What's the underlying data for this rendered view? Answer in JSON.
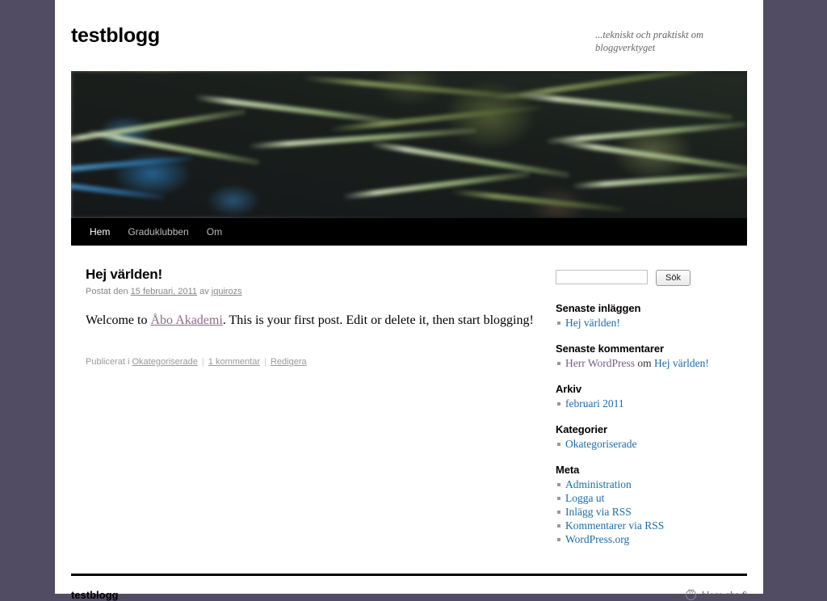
{
  "theme": {
    "background_color": "#514b63",
    "page_background": "#ffffff",
    "nav_background": "#000000",
    "link_color": "#1b6ca8",
    "visited_link_color": "#7a5a8e",
    "meta_text_color": "#888888"
  },
  "header": {
    "site_title": "testblogg",
    "site_description": "...tekniskt och praktiskt om bloggverktyget",
    "header_image_alt": "fern fronds photograph"
  },
  "nav": {
    "items": [
      {
        "label": "Hem",
        "current": true
      },
      {
        "label": "Graduklubben",
        "current": false
      },
      {
        "label": "Om",
        "current": false
      }
    ]
  },
  "post": {
    "title": "Hej världen!",
    "meta_prefix": "Postat den",
    "date": "15 februari, 2011",
    "meta_by": "av",
    "author": "jquirozs",
    "content_before_link": "Welcome to ",
    "content_link": "Åbo Akademi",
    "content_after_link": ". This is your first post. Edit or delete it, then start blogging!",
    "utility_prefix": "Publicerat i",
    "category": "Okategoriserade",
    "comments": "1 kommentar",
    "edit": "Redigera",
    "separator": "|"
  },
  "sidebar": {
    "search": {
      "value": "",
      "placeholder": "",
      "button_label": "Sök"
    },
    "widgets": [
      {
        "title": "Senaste inläggen",
        "items": [
          {
            "text": "Hej världen!",
            "style": "link"
          }
        ]
      },
      {
        "title": "Senaste kommentarer",
        "items": [
          {
            "text": "Herr WordPress om Hej världen!",
            "style": "composite",
            "parts": [
              {
                "text": "Herr WordPress",
                "style": "visited"
              },
              {
                "text": " om ",
                "style": "plain"
              },
              {
                "text": "Hej världen!",
                "style": "link"
              }
            ]
          }
        ]
      },
      {
        "title": "Arkiv",
        "items": [
          {
            "text": "februari 2011",
            "style": "link"
          }
        ]
      },
      {
        "title": "Kategorier",
        "items": [
          {
            "text": "Okategoriserade",
            "style": "link"
          }
        ]
      },
      {
        "title": "Meta",
        "items": [
          {
            "text": "Administration",
            "style": "link"
          },
          {
            "text": "Logga ut",
            "style": "link"
          },
          {
            "text": "Inlägg via RSS",
            "style": "link",
            "abbr": "RSS"
          },
          {
            "text": "Kommentarer via RSS",
            "style": "link",
            "abbr": "RSS"
          },
          {
            "text": "WordPress.org",
            "style": "link"
          }
        ]
      }
    ]
  },
  "footer": {
    "site_title": "testblogg",
    "credit_icon": "wordpress-logo-icon",
    "credit_text": "blogs.abo.fi"
  }
}
